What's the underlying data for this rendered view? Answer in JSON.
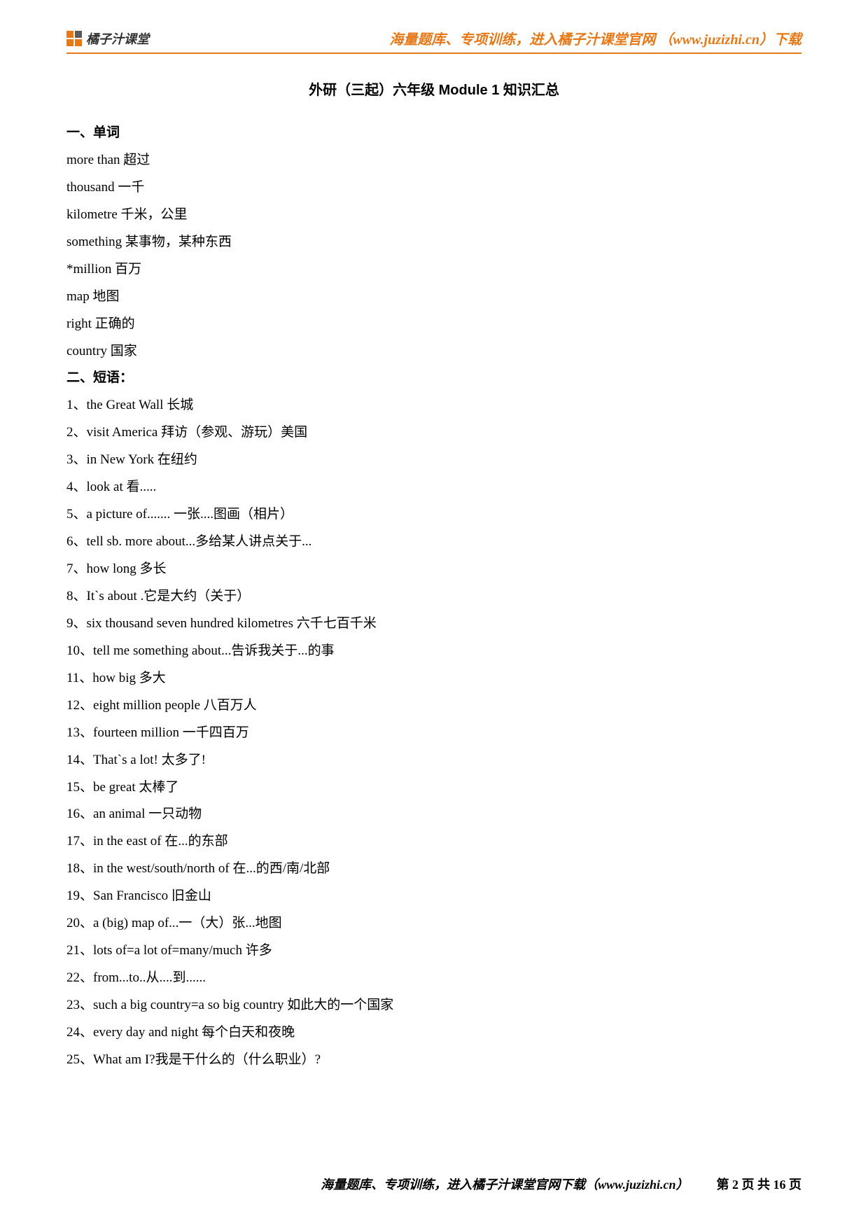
{
  "header": {
    "logo_text": "橘子汁课堂",
    "right_text": "海量题库、专项训练，进入橘子汁课堂官网 （www.juzizhi.cn）下载"
  },
  "title": "外研（三起）六年级 Module 1 知识汇总",
  "sections": {
    "s1_head": "一、单词",
    "s1_items": [
      "more than 超过",
      "thousand 一千",
      "kilometre 千米，公里",
      "something 某事物，某种东西",
      "*million 百万",
      "map 地图",
      "right 正确的",
      "country 国家"
    ],
    "s2_head": "二、短语：",
    "s2_items": [
      "1、the Great Wall 长城",
      "2、visit America 拜访（参观、游玩）美国",
      "3、in New York 在纽约",
      "4、look at 看.....",
      "5、a picture of....... 一张....图画（相片）",
      "6、tell sb. more about...多给某人讲点关于...",
      "7、how long 多长",
      "8、It`s about .它是大约（关于）",
      "9、six thousand seven hundred kilometres 六千七百千米",
      "10、tell me something about...告诉我关于...的事",
      "11、how big 多大",
      "12、eight million people 八百万人",
      "13、fourteen million 一千四百万",
      "14、That`s a lot! 太多了!",
      "15、be great 太棒了",
      "16、an animal 一只动物",
      "17、in the east of 在...的东部",
      "18、in the west/south/north of 在...的西/南/北部",
      "19、San Francisco 旧金山",
      "20、a (big) map of...一（大）张...地图",
      "21、lots of=a lot of=many/much 许多",
      "22、from...to..从....到......",
      "23、such a big country=a so big country 如此大的一个国家",
      "24、every day and night 每个白天和夜晚",
      "25、What am I?我是干什么的（什么职业）?"
    ]
  },
  "footer": {
    "left": "海量题库、专项训练，进入橘子汁课堂官网下载（www.juzizhi.cn）",
    "right": "第 2 页 共 16 页"
  }
}
